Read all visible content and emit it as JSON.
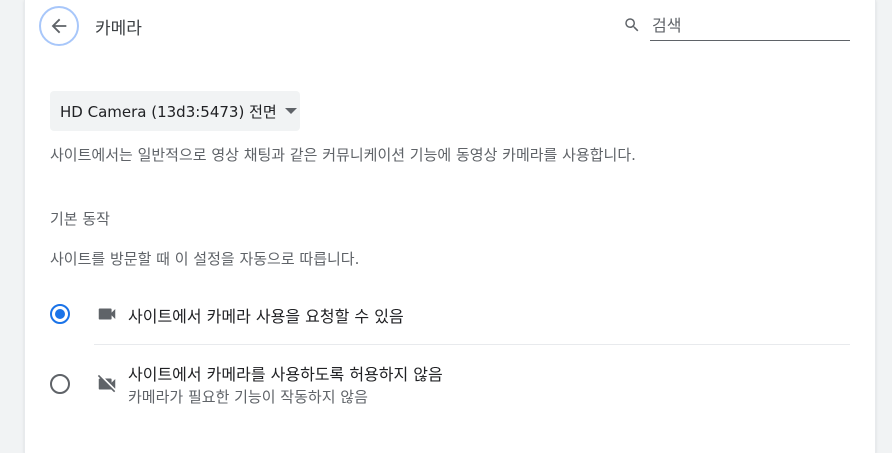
{
  "header": {
    "title": "카메라",
    "back_icon": "arrow-back-icon",
    "search": {
      "placeholder": "검색",
      "value": "",
      "icon": "search-icon"
    }
  },
  "device_select": {
    "selected": "HD Camera (13d3:5473) 전면"
  },
  "description": "사이트에서는 일반적으로 영상 채팅과 같은 커뮤니케이션 기능에 동영상 카메라를 사용합니다.",
  "default_behavior": {
    "title": "기본 동작",
    "subtitle": "사이트를 방문할 때 이 설정을 자동으로 따릅니다.",
    "options": [
      {
        "label": "사이트에서 카메라 사용을 요청할 수 있음",
        "sublabel": "",
        "checked": true,
        "icon": "videocam-icon"
      },
      {
        "label": "사이트에서 카메라를 사용하도록 허용하지 않음",
        "sublabel": "카메라가 필요한 기능이 작동하지 않음",
        "checked": false,
        "icon": "videocam-off-icon"
      }
    ]
  },
  "colors": {
    "accent": "#1a73e8",
    "text": "#202124",
    "secondary_text": "#5f6368"
  }
}
